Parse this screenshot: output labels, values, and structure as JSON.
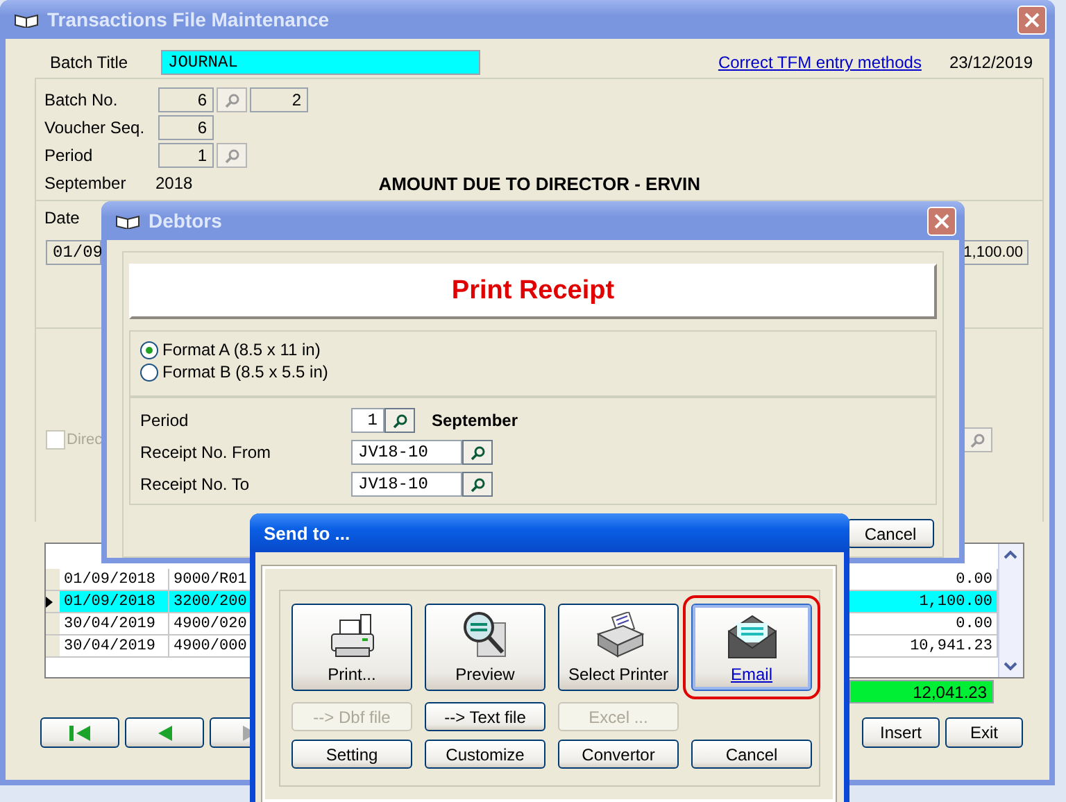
{
  "main_window": {
    "title": "Transactions File Maintenance",
    "batch_title_label": "Batch Title",
    "batch_title": "JOURNAL",
    "link": "Correct TFM entry methods",
    "date": "23/12/2019",
    "fields": [
      {
        "label": "Batch No.",
        "value": "6",
        "lookup": true,
        "extra": "2"
      },
      {
        "label": "Voucher Seq.",
        "value": "6",
        "lookup": false
      },
      {
        "label": "Period",
        "value": "1",
        "lookup": true
      }
    ],
    "month": "September",
    "year": "2018",
    "account_name": "AMOUNT DUE TO DIRECTOR - ERVIN",
    "date_label": "Date",
    "date_value": "01/09",
    "amount": "1,100.00",
    "checkbox": {
      "label": "Direc",
      "checked": false,
      "disabled": true
    },
    "grid_rows": [
      {
        "date": "01/09/2018",
        "account": "9000/R01",
        "amount": "0.00",
        "selected": false
      },
      {
        "date": "01/09/2018",
        "account": "3200/200",
        "amount": "1,100.00",
        "selected": true
      },
      {
        "date": "30/04/2019",
        "account": "4900/020",
        "amount": "0.00",
        "selected": false
      },
      {
        "date": "30/04/2019",
        "account": "4900/000",
        "amount": "10,941.23",
        "selected": false
      }
    ],
    "total": "12,041.23",
    "nav_buttons": [
      {
        "kind": "first"
      },
      {
        "kind": "prev"
      },
      {
        "kind": "next"
      }
    ],
    "buttons": [
      "Insert",
      "Exit"
    ]
  },
  "debtors": {
    "title": "Debtors",
    "banner": "Print Receipt",
    "formats": [
      {
        "label": "Format A (8.5 x 11 in)",
        "selected": true
      },
      {
        "label": "Format B (8.5 x 5.5 in)",
        "selected": false
      }
    ],
    "period_label": "Period",
    "period": "1",
    "period_name": "September",
    "from_label": "Receipt No. From",
    "from": "JV18-10",
    "to_label": "Receipt No. To",
    "to": "JV18-10",
    "cancel": "Cancel"
  },
  "send_to": {
    "title": "Send to ...",
    "actions": [
      {
        "label": "Print...",
        "kind": "printer",
        "selected": false
      },
      {
        "label": "Preview",
        "kind": "preview",
        "selected": false
      },
      {
        "label": "Select Printer",
        "kind": "setup",
        "selected": false
      },
      {
        "label": "Email",
        "kind": "mail",
        "selected": true
      }
    ],
    "exports": [
      {
        "label": "--> Dbf file",
        "disabled": true
      },
      {
        "label": "--> Text file",
        "disabled": false
      },
      {
        "label": "Excel ...",
        "disabled": true
      }
    ],
    "buttons": [
      "Setting",
      "Customize",
      "Convertor",
      "Cancel"
    ]
  }
}
